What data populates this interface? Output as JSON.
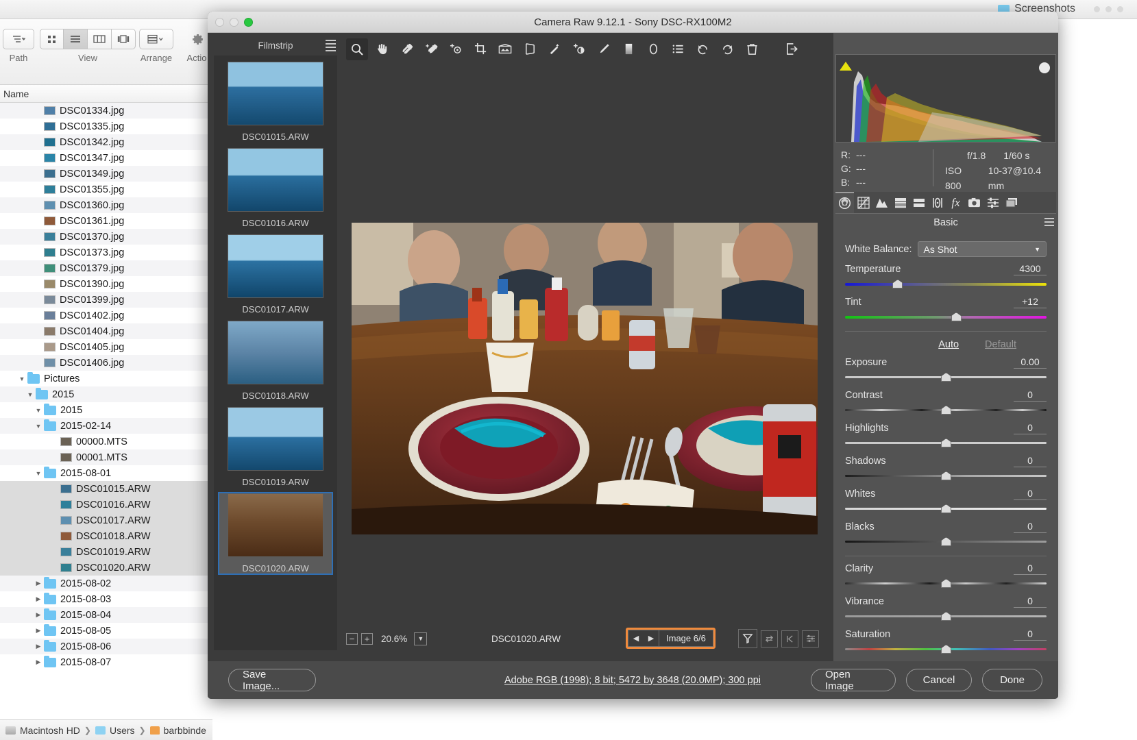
{
  "finder": {
    "tab_label": "Screenshots",
    "toolbar": {
      "path_label": "Path",
      "view_label": "View",
      "arrange_label": "Arrange",
      "action_label": "Actio"
    },
    "column_header": "Name",
    "path_bar": [
      "Macintosh HD",
      "Users",
      "barbbinde"
    ],
    "rows": [
      {
        "name": "DSC01334.jpg",
        "indent": 4,
        "type": "image",
        "disc": "",
        "sel": false
      },
      {
        "name": "DSC01335.jpg",
        "indent": 4,
        "type": "image",
        "disc": "",
        "sel": false
      },
      {
        "name": "DSC01342.jpg",
        "indent": 4,
        "type": "image",
        "disc": "",
        "sel": false
      },
      {
        "name": "DSC01347.jpg",
        "indent": 4,
        "type": "image",
        "disc": "",
        "sel": false
      },
      {
        "name": "DSC01349.jpg",
        "indent": 4,
        "type": "image",
        "disc": "",
        "sel": false
      },
      {
        "name": "DSC01355.jpg",
        "indent": 4,
        "type": "image",
        "disc": "",
        "sel": false
      },
      {
        "name": "DSC01360.jpg",
        "indent": 4,
        "type": "image",
        "disc": "",
        "sel": false
      },
      {
        "name": "DSC01361.jpg",
        "indent": 4,
        "type": "image",
        "disc": "",
        "sel": false
      },
      {
        "name": "DSC01370.jpg",
        "indent": 4,
        "type": "image",
        "disc": "",
        "sel": false
      },
      {
        "name": "DSC01373.jpg",
        "indent": 4,
        "type": "image",
        "disc": "",
        "sel": false
      },
      {
        "name": "DSC01379.jpg",
        "indent": 4,
        "type": "image",
        "disc": "",
        "sel": false
      },
      {
        "name": "DSC01390.jpg",
        "indent": 4,
        "type": "image",
        "disc": "",
        "sel": false
      },
      {
        "name": "DSC01399.jpg",
        "indent": 4,
        "type": "image",
        "disc": "",
        "sel": false
      },
      {
        "name": "DSC01402.jpg",
        "indent": 4,
        "type": "image",
        "disc": "",
        "sel": false
      },
      {
        "name": "DSC01404.jpg",
        "indent": 4,
        "type": "image",
        "disc": "",
        "sel": false
      },
      {
        "name": "DSC01405.jpg",
        "indent": 4,
        "type": "image",
        "disc": "",
        "sel": false
      },
      {
        "name": "DSC01406.jpg",
        "indent": 4,
        "type": "image",
        "disc": "",
        "sel": false
      },
      {
        "name": "Pictures",
        "indent": 2,
        "type": "folder",
        "disc": "open",
        "sel": false
      },
      {
        "name": "2015",
        "indent": 3,
        "type": "folder",
        "disc": "open",
        "sel": false
      },
      {
        "name": "2015",
        "indent": 4,
        "type": "folder",
        "disc": "open",
        "sel": false
      },
      {
        "name": "2015-02-14",
        "indent": 4,
        "type": "folder",
        "disc": "open",
        "sel": false
      },
      {
        "name": "00000.MTS",
        "indent": 6,
        "type": "video",
        "disc": "",
        "sel": false
      },
      {
        "name": "00001.MTS",
        "indent": 6,
        "type": "video",
        "disc": "",
        "sel": false
      },
      {
        "name": "2015-08-01",
        "indent": 4,
        "type": "folder",
        "disc": "open",
        "sel": false
      },
      {
        "name": "DSC01015.ARW",
        "indent": 6,
        "type": "image",
        "disc": "",
        "sel": true
      },
      {
        "name": "DSC01016.ARW",
        "indent": 6,
        "type": "image",
        "disc": "",
        "sel": true
      },
      {
        "name": "DSC01017.ARW",
        "indent": 6,
        "type": "image",
        "disc": "",
        "sel": true
      },
      {
        "name": "DSC01018.ARW",
        "indent": 6,
        "type": "image",
        "disc": "",
        "sel": true
      },
      {
        "name": "DSC01019.ARW",
        "indent": 6,
        "type": "image",
        "disc": "",
        "sel": true
      },
      {
        "name": "DSC01020.ARW",
        "indent": 6,
        "type": "image",
        "disc": "",
        "sel": true
      },
      {
        "name": "2015-08-02",
        "indent": 4,
        "type": "folder",
        "disc": "closed",
        "sel": false
      },
      {
        "name": "2015-08-03",
        "indent": 4,
        "type": "folder",
        "disc": "closed",
        "sel": false
      },
      {
        "name": "2015-08-04",
        "indent": 4,
        "type": "folder",
        "disc": "closed",
        "sel": false
      },
      {
        "name": "2015-08-05",
        "indent": 4,
        "type": "folder",
        "disc": "closed",
        "sel": false
      },
      {
        "name": "2015-08-06",
        "indent": 4,
        "type": "folder",
        "disc": "closed",
        "sel": false
      },
      {
        "name": "2015-08-07",
        "indent": 4,
        "type": "folder",
        "disc": "closed",
        "sel": false
      }
    ]
  },
  "acr": {
    "title": "Camera Raw 9.12.1  -  Sony DSC-RX100M2",
    "filmstrip_label": "Filmstrip",
    "filmstrip": [
      {
        "caption": "DSC01015.ARW",
        "active": false
      },
      {
        "caption": "DSC01016.ARW",
        "active": false
      },
      {
        "caption": "DSC01017.ARW",
        "active": false
      },
      {
        "caption": "DSC01018.ARW",
        "active": false
      },
      {
        "caption": "DSC01019.ARW",
        "active": false
      },
      {
        "caption": "DSC01020.ARW",
        "active": true
      }
    ],
    "tools": [
      "zoom-tool",
      "hand-tool",
      "white-balance-eyedropper-tool",
      "color-sampler-tool",
      "targeted-adjustment-tool",
      "crop-tool",
      "straighten-tool",
      "transform-tool",
      "spot-removal-tool",
      "red-eye-removal-tool",
      "adjustment-brush-tool",
      "graduated-filter-tool",
      "radial-filter-tool",
      "preferences-tool",
      "rotate-counterclockwise-tool",
      "rotate-clockwise-tool",
      "delete-tool"
    ],
    "statusbar": {
      "zoom_out": "−",
      "zoom_in": "+",
      "zoom_level": "20.6%",
      "filename": "DSC01020.ARW",
      "prev_arrow": "◀",
      "next_arrow": "▶",
      "image_counter": "Image 6/6",
      "highlight_color": "#f08a3c"
    },
    "histogram": {
      "r_label": "R:",
      "g_label": "G:",
      "b_label": "B:",
      "r_value": "---",
      "g_value": "---",
      "b_value": "---"
    },
    "exif": {
      "aperture": "f/1.8",
      "shutter": "1/60 s",
      "iso": "ISO 800",
      "lens": "10-37@10.4 mm"
    },
    "panel_tabs": [
      "basic-panel-tab",
      "tone-curve-panel-tab",
      "detail-panel-tab",
      "hsl-grayscale-panel-tab",
      "split-toning-panel-tab",
      "lens-corrections-panel-tab",
      "effects-panel-tab",
      "camera-calibration-panel-tab",
      "presets-panel-tab",
      "snapshots-panel-tab"
    ],
    "panel_title": "Basic",
    "white_balance": {
      "label": "White Balance:",
      "value": "As Shot"
    },
    "auto_label": "Auto",
    "default_label": "Default",
    "sliders": [
      {
        "name": "Temperature",
        "value": "4300",
        "pos": 26,
        "bar": "bar-temp"
      },
      {
        "name": "Tint",
        "value": "+12",
        "pos": 55,
        "bar": "bar-tint"
      },
      {
        "name": "Exposure",
        "value": "0.00",
        "pos": 50,
        "bar": "bar-plain"
      },
      {
        "name": "Contrast",
        "value": "0",
        "pos": 50,
        "bar": "bar-contrast"
      },
      {
        "name": "Highlights",
        "value": "0",
        "pos": 50,
        "bar": "bar-plain"
      },
      {
        "name": "Shadows",
        "value": "0",
        "pos": 50,
        "bar": "bar-shadow"
      },
      {
        "name": "Whites",
        "value": "0",
        "pos": 50,
        "bar": "bar-white"
      },
      {
        "name": "Blacks",
        "value": "0",
        "pos": 50,
        "bar": "bar-black"
      },
      {
        "name": "Clarity",
        "value": "0",
        "pos": 50,
        "bar": "bar-clarity"
      },
      {
        "name": "Vibrance",
        "value": "0",
        "pos": 50,
        "bar": "bar-vib"
      },
      {
        "name": "Saturation",
        "value": "0",
        "pos": 50,
        "bar": "bar-sat"
      }
    ],
    "footer": {
      "save_image": "Save Image...",
      "workflow_link": "Adobe RGB (1998); 8 bit; 5472 by 3648 (20.0MP); 300 ppi",
      "open_image": "Open Image",
      "cancel": "Cancel",
      "done": "Done"
    }
  }
}
